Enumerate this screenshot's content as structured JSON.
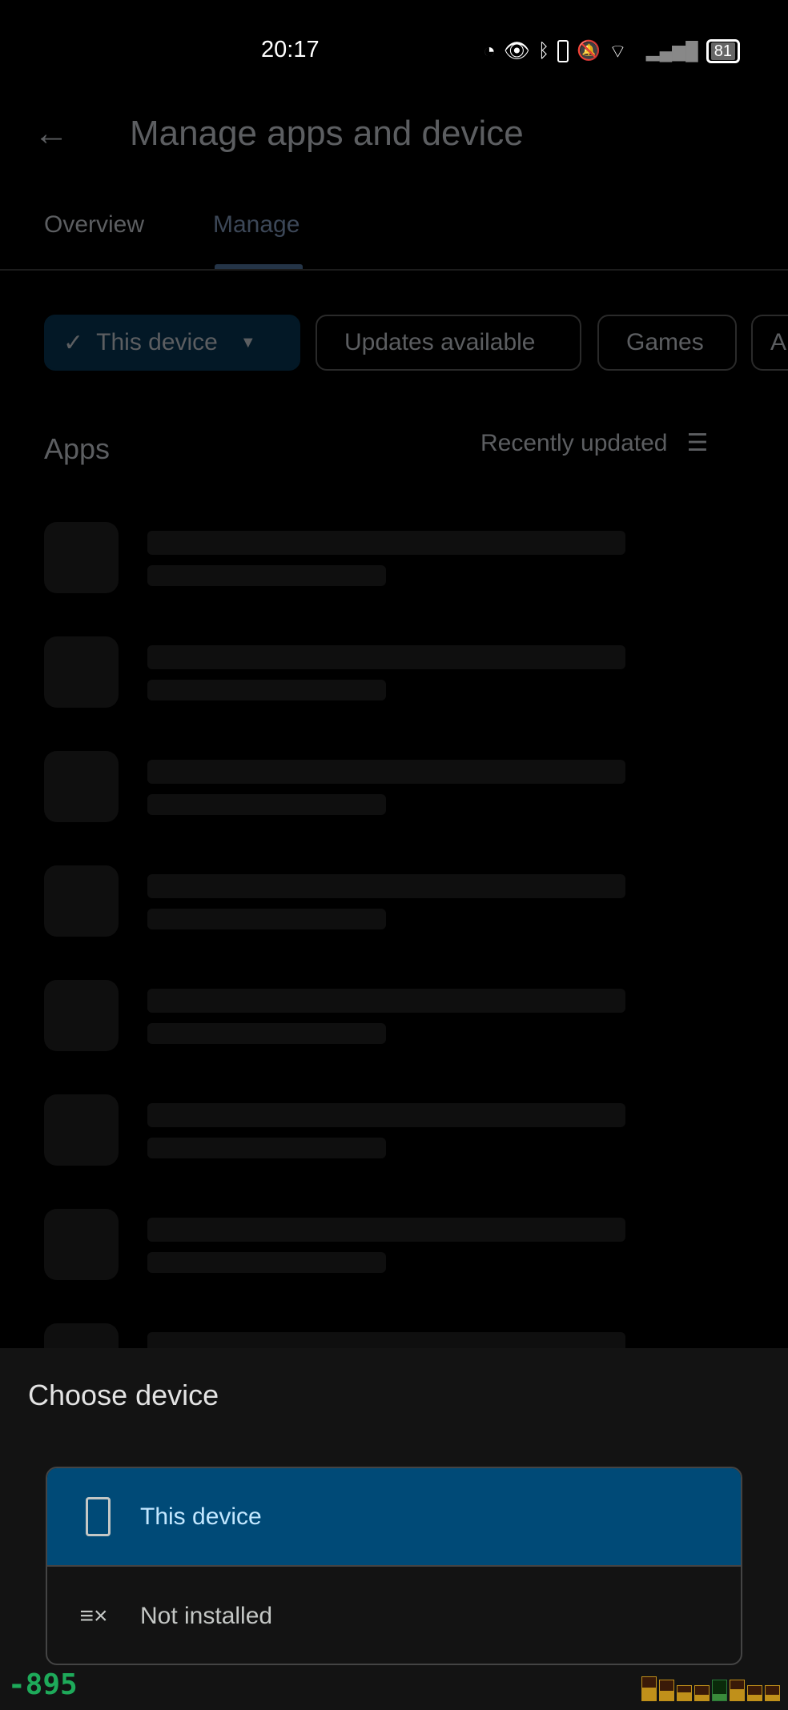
{
  "status": {
    "time": "20:17",
    "battery": "81",
    "icons": [
      "data-saver-icon",
      "eye-icon",
      "bluetooth-icon",
      "battery-icon",
      "bell-off-icon",
      "wifi-icon",
      "signal-icon"
    ]
  },
  "header": {
    "title": "Manage apps and device",
    "back_icon": "arrow-back-icon"
  },
  "tabs": [
    {
      "label": "Overview"
    },
    {
      "label": "Manage",
      "active": true
    }
  ],
  "chips": [
    {
      "label": "This device",
      "selected": true
    },
    {
      "label": "Updates available"
    },
    {
      "label": "Games"
    },
    {
      "label": "A"
    }
  ],
  "list": {
    "heading": "Apps",
    "sort_label": "Recently updated"
  },
  "sheet": {
    "title": "Choose device",
    "options": [
      {
        "label": "This device",
        "icon": "phone-icon",
        "selected": true
      },
      {
        "label": "Not installed",
        "icon": "list-remove-icon"
      }
    ]
  },
  "overlay": {
    "counter": "-895"
  },
  "colors": {
    "selected_bg": "#004a77",
    "selected_text": "#c2e7ff",
    "sheet_bg": "#131313"
  }
}
